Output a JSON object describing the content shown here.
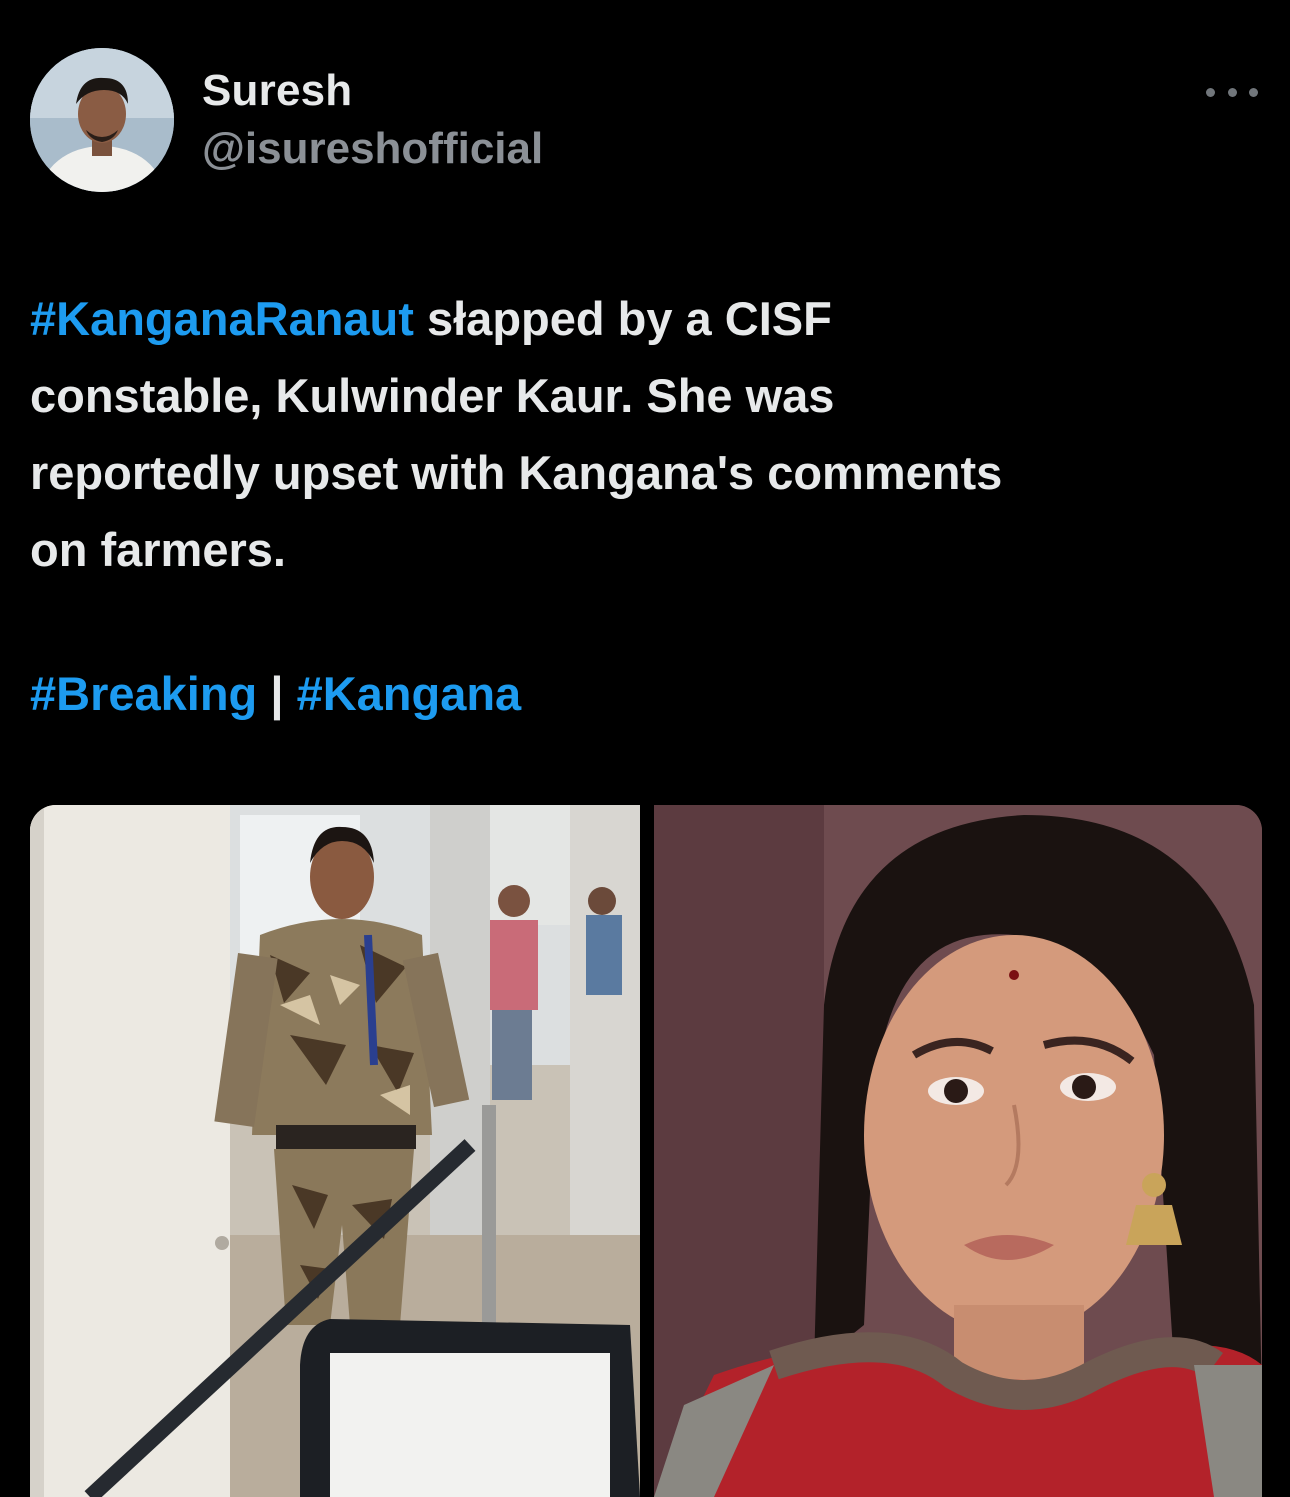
{
  "author": {
    "display_name": "Suresh",
    "handle": "@isureshofficial"
  },
  "more_icon": "more-horizontal-icon",
  "tweet": {
    "hashtag_main": "#KanganaRanaut",
    "line1_rest": " słapped by a CISF",
    "line2": "constable, Kulwinder Kaur. She was",
    "line3": "reportedly upset with Kangana's comments",
    "line4": "on farmers.",
    "tag1": "#Breaking",
    "separator": " | ",
    "tag2": "#Kangana"
  },
  "media": [
    {
      "name": "cisf-constable-photo"
    },
    {
      "name": "kangana-portrait-photo"
    }
  ],
  "colors": {
    "background": "#000000",
    "text": "#e7e9ea",
    "secondary_text": "#8b9096",
    "hashtag": "#1d9bf0"
  }
}
